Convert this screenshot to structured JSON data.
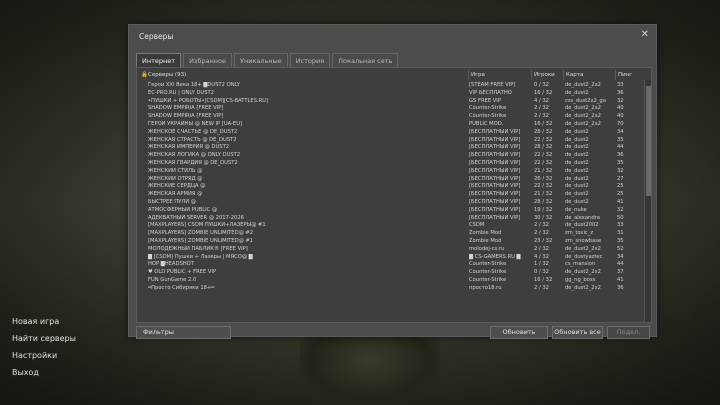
{
  "dialog": {
    "title": "Серверы",
    "close": "✕"
  },
  "tabs": [
    {
      "label": "Интернет"
    },
    {
      "label": "Избранное"
    },
    {
      "label": "Уникальные"
    },
    {
      "label": "История"
    },
    {
      "label": "Локальная сеть"
    }
  ],
  "table": {
    "header": {
      "lock": "🔒",
      "name": "Серверы (93)",
      "game": "Игра",
      "players": "Игроки",
      "map": "Карта",
      "ping": "Пинг"
    },
    "rows": [
      {
        "lock": "",
        "name": "Герои XXI Века 18+ █DUST2 ONLY",
        "game": "[STEAM FREE VIP]",
        "players": "0 / 32",
        "map": "de_dust2_2x2",
        "ping": "33"
      },
      {
        "lock": "",
        "name": "EC-PRO.RU | ONLY DUST2",
        "game": "VIP БЕСПЛАТНО",
        "players": "16 / 32",
        "map": "de_dust2",
        "ping": "36"
      },
      {
        "lock": "",
        "name": "•ПУШКИ + РОБОТЫ•[CSDM][CS-BATTLES.RU]",
        "game": "GS FREE VIP",
        "players": "4 / 32",
        "map": "css_dust2x2_go",
        "ping": "32"
      },
      {
        "lock": "",
        "name": "SHADOW EMPIRIA [FREE VIP]",
        "game": "Counter-Strike",
        "players": "2 / 32",
        "map": "de_dust2_2x2",
        "ping": "40"
      },
      {
        "lock": "",
        "name": "SHADOW EMPIRIA [FREE VIP]",
        "game": "Counter-Strike",
        "players": "2 / 32",
        "map": "de_dust2_2x2",
        "ping": "40"
      },
      {
        "lock": "",
        "name": "ГЕРОИ УКРАИНЫ @ NEW IP [UA-EU]",
        "game": "PUBLIC MOD.",
        "players": "16 / 32",
        "map": "de_dust2_2x2",
        "ping": "70"
      },
      {
        "lock": "",
        "name": "ЖЕНСКОЕ СЧАСТЬЕ @ DE_DUST2",
        "game": "[БЕСПЛАТНЫЙ VIP]",
        "players": "28 / 32",
        "map": "de_dust2",
        "ping": "34"
      },
      {
        "lock": "",
        "name": "ЖЕНСКАЯ СТРАСТЬ @ DE_DUST2",
        "game": "[БЕСПЛАТНЫЙ VIP]",
        "players": "22 / 32",
        "map": "de_dust2",
        "ping": "35"
      },
      {
        "lock": "",
        "name": "ЖЕНСКАЯ ИМПЕРИЯ @ DUST2",
        "game": "[БЕСПЛАТНЫЙ VIP]",
        "players": "28 / 32",
        "map": "de_dust2",
        "ping": "44"
      },
      {
        "lock": "",
        "name": "ЖЕНСКАЯ ЛОГИКА @ ONLY DUST2",
        "game": "[БЕСПЛАТНЫЙ VIP]",
        "players": "22 / 32",
        "map": "de_dust2",
        "ping": "36"
      },
      {
        "lock": "",
        "name": "ЖЕНСКАЯ ГВАРДИЯ @ DE_DUST2",
        "game": "[БЕСПЛАТНЫЙ VIP]",
        "players": "22 / 32",
        "map": "de_dust2",
        "ping": "35"
      },
      {
        "lock": "",
        "name": "ЖЕНСКИЙ СТИЛЬ @",
        "game": "[БЕСПЛАТНЫЙ VIP]",
        "players": "21 / 32",
        "map": "de_dust2",
        "ping": "32"
      },
      {
        "lock": "",
        "name": "ЖЕНСКИЙ ОТРЯД @",
        "game": "[БЕСПЛАТНЫЙ VIP]",
        "players": "26 / 32",
        "map": "de_dust2",
        "ping": "27"
      },
      {
        "lock": "",
        "name": "ЖЕНСКИЕ СЕРДЦА @",
        "game": "[БЕСПЛАТНЫЙ VIP]",
        "players": "22 / 32",
        "map": "de_dust2",
        "ping": "25"
      },
      {
        "lock": "",
        "name": "ЖЕНСКАЯ АРМИЯ @",
        "game": "[БЕСПЛАТНЫЙ VIP]",
        "players": "21 / 32",
        "map": "de_dust2",
        "ping": "25"
      },
      {
        "lock": "",
        "name": "БЫСТРЕЕ ПУЛИ @",
        "game": "[БЕСПЛАТНЫЙ VIP]",
        "players": "28 / 32",
        "map": "de_dust2",
        "ping": "41"
      },
      {
        "lock": "",
        "name": "АТМОСФЕРНЫЙ PUBLIC @",
        "game": "[БЕСПЛАТНЫЙ VIP]",
        "players": "19 / 32",
        "map": "de_nuke",
        "ping": "32"
      },
      {
        "lock": "",
        "name": "АДЕКВАТНЫЙ SERVER @ 2017-2026",
        "game": "[БЕСПЛАТНЫЙ VIP]",
        "players": "30 / 32",
        "map": "de_alexandra",
        "ping": "50"
      },
      {
        "lock": "",
        "name": "[MAXPLAYERS] CSDM ПУШКИ+ЛАЗЕРЫ@ #1",
        "game": "CSDM",
        "players": "2 / 32",
        "map": "de_dust2002",
        "ping": "33"
      },
      {
        "lock": "",
        "name": "[MAXPLAYERS] ZOMBIE UNLIMITED@ #2",
        "game": "Zombie Mod",
        "players": "2 / 32",
        "map": "zm_toxic_z",
        "ping": "31"
      },
      {
        "lock": "",
        "name": "[MAXPLAYERS] ZOMBIE UNLIMITED@ #1",
        "game": "Zombie Mod",
        "players": "23 / 32",
        "map": "zm_snowbase",
        "ping": "35"
      },
      {
        "lock": "",
        "name": "МОЛОДЁЖНЫЙ ПАБЛИК® [FREE VIP]",
        "game": "molodej-cs.ru",
        "players": "2 / 32",
        "map": "de_dust2_2x2",
        "ping": "52"
      },
      {
        "lock": "",
        "name": "█ [CSDM] Пушки + Лазеры | МЯСО@ █",
        "game": "█ CS-GAMERS.RU █",
        "players": "4 / 32",
        "map": "de_dustyaztec",
        "ping": "34"
      },
      {
        "lock": "",
        "name": "HOP █HEADSHOT",
        "game": "Counter-Strike",
        "players": "1 / 32",
        "map": "cs_mansion",
        "ping": "44"
      },
      {
        "lock": "",
        "name": "♥ OLD PUBLIC + FREE VIP",
        "game": "Counter-Strike",
        "players": "0 / 32",
        "map": "de_dust2_2x2",
        "ping": "37"
      },
      {
        "lock": "",
        "name": "FUN GunGame 2.0",
        "game": "Counter-Strike",
        "players": "16 / 32",
        "map": "gg_ng_boss",
        "ping": "41"
      },
      {
        "lock": "",
        "name": "═Просто Сибиряки 18+═",
        "game": "просто18.ru",
        "players": "2 / 32",
        "map": "de_dust2_2x2",
        "ping": "36"
      }
    ]
  },
  "buttons": {
    "filters": "Фильтры",
    "refresh": "Обновить",
    "refresh_all": "Обновить все",
    "connect": "Подкл."
  },
  "main_menu": [
    {
      "label": "Новая игра"
    },
    {
      "label": "Найти серверы"
    },
    {
      "label": "Настройки"
    },
    {
      "label": "Выход"
    }
  ]
}
